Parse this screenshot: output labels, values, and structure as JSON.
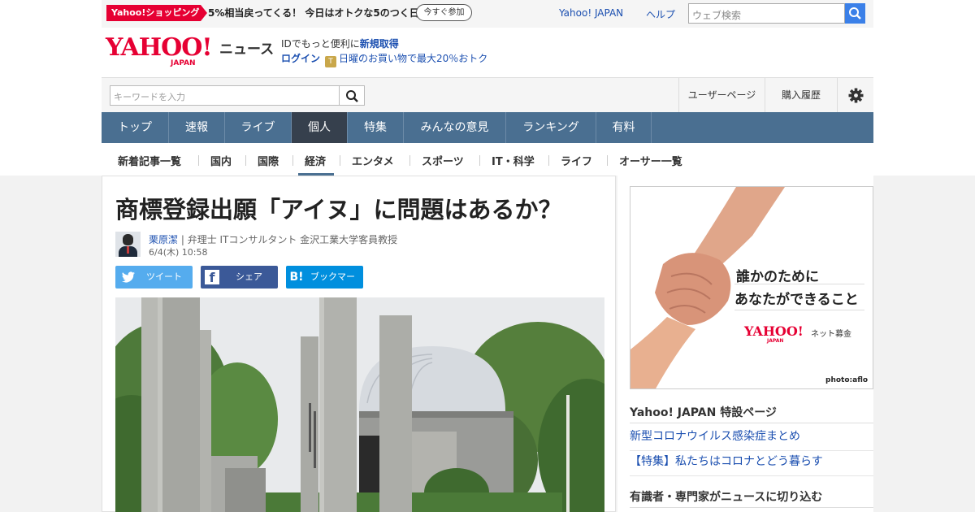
{
  "colors": {
    "brand_red": "#e60033",
    "nav_bg": "#4a6f91",
    "nav_active": "#36404d",
    "link_blue": "#1b4fb0"
  },
  "topbar": {
    "shopping_badge": "Yahoo!ショッピング",
    "shopping_promo": "5%相当戻ってくる！ 今日はオトクな5のつく日",
    "join_button": "今すぐ参加",
    "yahoo_japan_link": "Yahoo! JAPAN",
    "help_link": "ヘルプ",
    "web_search_placeholder": "ウェブ検索"
  },
  "header": {
    "logo_text": "YAHOO!",
    "logo_sub": "JAPAN",
    "news_label": "ニュース",
    "promo_id_prefix": "IDでもっと便利に",
    "promo_id_link": "新規取得",
    "login_link": "ログイン",
    "coupon_icon": "T",
    "sunday_promo": "日曜のお買い物で最大20％おトク"
  },
  "searchbar": {
    "keyword_placeholder": "キーワードを入力",
    "user_page": "ユーザーページ",
    "purchase_history": "購入履歴"
  },
  "nav": {
    "items": [
      {
        "label": "トップ"
      },
      {
        "label": "速報"
      },
      {
        "label": "ライブ"
      },
      {
        "label": "個人"
      },
      {
        "label": "特集"
      },
      {
        "label": "みんなの意見"
      },
      {
        "label": "ランキング"
      },
      {
        "label": "有料"
      }
    ],
    "active": "個人"
  },
  "subnav": {
    "items": [
      {
        "label": "新着記事一覧"
      },
      {
        "label": "国内"
      },
      {
        "label": "国際"
      },
      {
        "label": "経済"
      },
      {
        "label": "エンタメ"
      },
      {
        "label": "スポーツ"
      },
      {
        "label": "IT・科学"
      },
      {
        "label": "ライフ"
      },
      {
        "label": "オーサー一覧"
      }
    ],
    "active": "経済"
  },
  "article": {
    "headline": "商標登録出願「アイヌ」に問題はあるか？",
    "author_name": "栗原潔",
    "author_title": " | 弁理士 ITコンサルタント 金沢工業大学客員教授",
    "date": "6/4(木) 10:58",
    "share_tweet": "ツイート",
    "share_facebook": "シェア",
    "share_bookmark": "ブックマーク",
    "facebook_glyph": "f",
    "hatena_glyph": "B!"
  },
  "sidebar": {
    "ad_line1": "誰かのために",
    "ad_line2": "あなたができること",
    "ad_logo": "YAHOO!",
    "ad_logo_sub": "JAPAN",
    "ad_logo_tag": "ネット募金",
    "ad_credit": "photo:aflo",
    "special_heading": "Yahoo! JAPAN 特設ページ",
    "special_links": [
      {
        "label": "新型コロナウイルス感染症まとめ"
      },
      {
        "label": "【特集】私たちはコロナとどう暮らす"
      }
    ],
    "experts_heading": "有識者・専門家がニュースに切り込む"
  }
}
